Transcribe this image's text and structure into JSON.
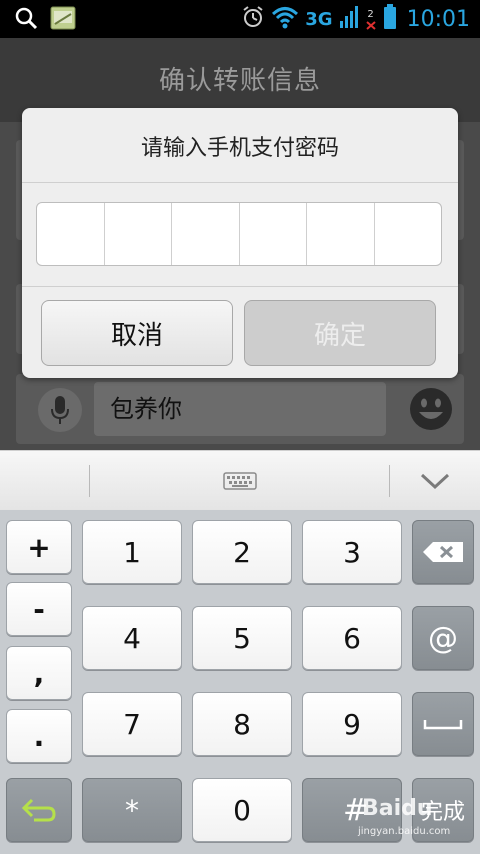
{
  "status_bar": {
    "network": "3G",
    "sim2": "2",
    "time": "10:01",
    "accent": "#2aa6e0"
  },
  "page": {
    "title": "确认转账信息"
  },
  "background": {
    "message_text": "包养你"
  },
  "dialog": {
    "title": "请输入手机支付密码",
    "password_cells": [
      "",
      "",
      "",
      "",
      "",
      ""
    ],
    "cancel_label": "取消",
    "confirm_label": "确定"
  },
  "keyboard": {
    "left_column": [
      "+",
      "-",
      ",",
      "."
    ],
    "digits": [
      "1",
      "2",
      "3",
      "4",
      "5",
      "6",
      "7",
      "8",
      "9",
      "*",
      "0",
      "#"
    ],
    "at_key": "@",
    "done_label": "完成"
  },
  "watermark": {
    "brand": "Baidu",
    "url": "jingyan.baidu.com"
  }
}
